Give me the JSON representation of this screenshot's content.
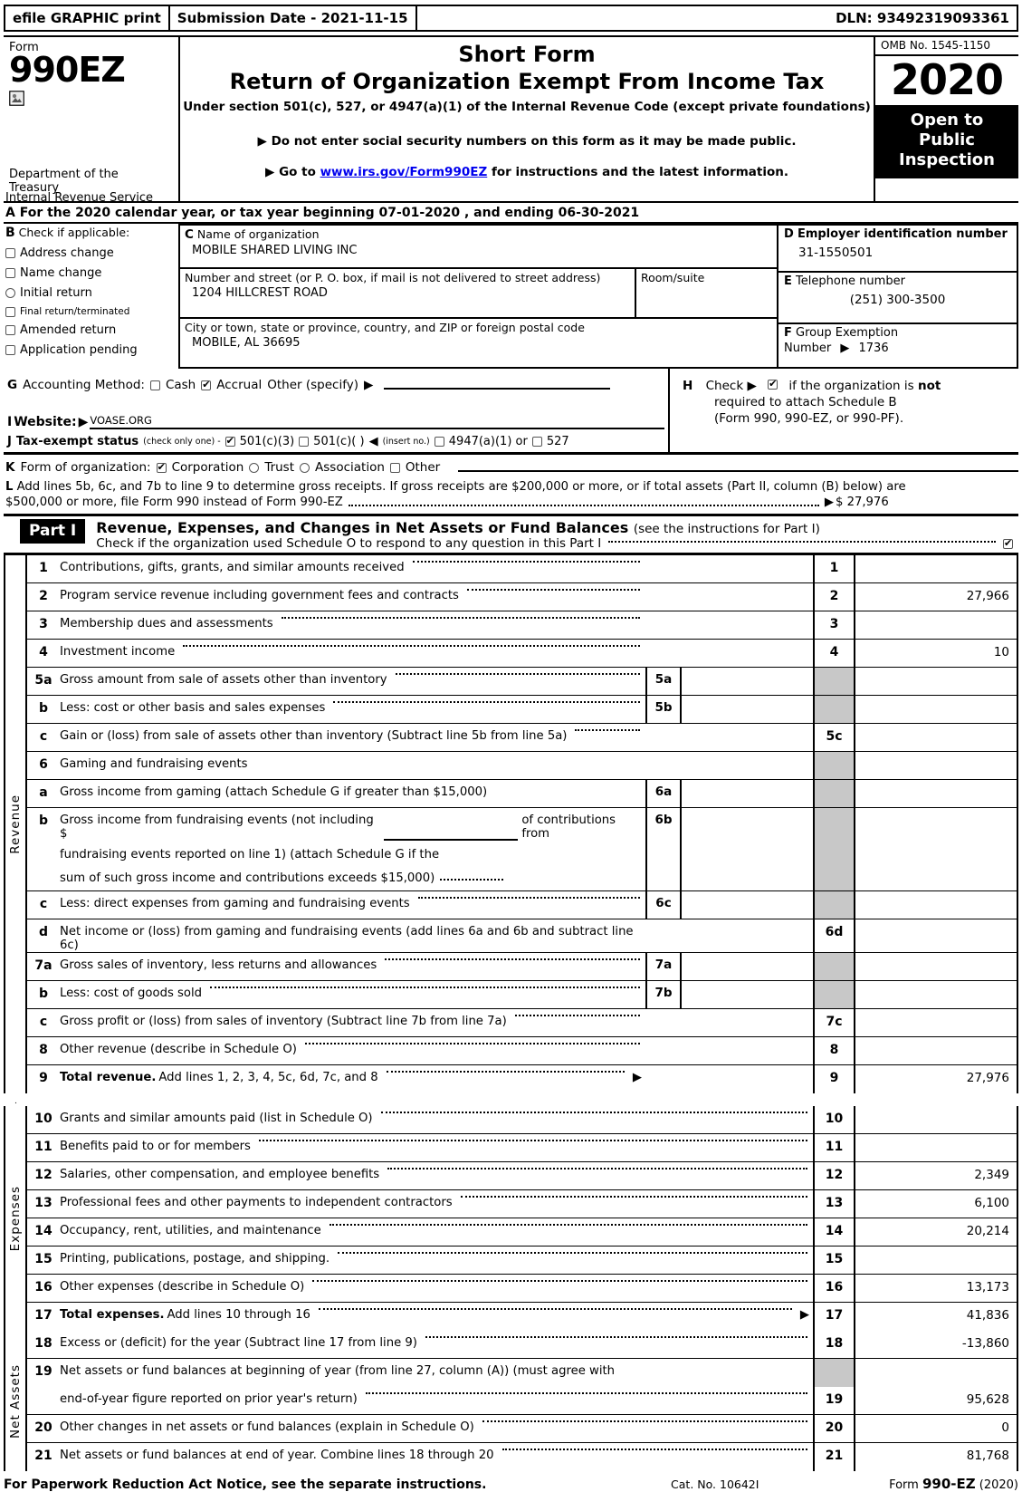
{
  "efile": {
    "graphic_print": "efile GRAPHIC print",
    "submission_date": "Submission Date - 2021-11-15",
    "dln": "DLN: 93492319093361"
  },
  "masthead": {
    "form_label": "Form",
    "form_number": "990EZ",
    "department": "Department of the Treasury",
    "department2": "Internal Revenue Service",
    "title_line1": "Short Form",
    "title_line2": "Return of Organization Exempt From Income Tax",
    "subtitle": "Under section 501(c), 527, or 4947(a)(1) of the Internal Revenue Code (except private foundations)",
    "bullet1": "Do not enter social security numbers on this form as it may be made public.",
    "bullet2_prefix": "Go to",
    "bullet2_url": "www.irs.gov/Form990EZ",
    "bullet2_suffix": "for instructions and the latest information.",
    "omb": "OMB No. 1545-1150",
    "year": "2020",
    "open_to_public": "Open to\nPublic\nInspection"
  },
  "line_a": "A  For the 2020 calendar year, or tax year beginning 07-01-2020 , and ending 06-30-2021",
  "section_b": {
    "letter": "B",
    "heading": "Check if applicable:",
    "items": [
      {
        "label": "Address change",
        "checked": false
      },
      {
        "label": "Name change",
        "checked": false
      },
      {
        "label": "Initial return",
        "checked": false
      },
      {
        "label": "Final return/terminated",
        "checked": false
      },
      {
        "label": "Amended return",
        "checked": false
      },
      {
        "label": "Application pending",
        "checked": false
      }
    ]
  },
  "section_c": {
    "letter": "C",
    "name_label": "Name of organization",
    "name_value": "MOBILE SHARED LIVING INC",
    "street_label": "Number and street (or P. O. box, if mail is not delivered to street address)",
    "street_value": "1204 HILLCREST ROAD",
    "room_label": "Room/suite",
    "room_value": "",
    "city_label": "City or town, state or province, country, and ZIP or foreign postal code",
    "city_value": "MOBILE, AL   36695"
  },
  "section_d": {
    "letter": "D",
    "label": "Employer identification number",
    "value": "31-1550501"
  },
  "section_e": {
    "letter": "E",
    "label": "Telephone number",
    "value": "(251) 300-3500"
  },
  "section_f": {
    "letter": "F",
    "label": "Group Exemption",
    "label2": "Number",
    "value": "1736"
  },
  "section_g": {
    "letter": "G",
    "label": "Accounting Method:",
    "cash": "Cash",
    "cash_checked": false,
    "accrual": "Accrual",
    "accrual_checked": true,
    "other": "Other (specify)",
    "other_value": ""
  },
  "section_h": {
    "letter": "H",
    "check_word": "Check",
    "checked": true,
    "text1": "if the organization is ",
    "text1_bold": "not",
    "text2": "required to attach Schedule B",
    "text3": "(Form 990, 990-EZ, or 990-PF)."
  },
  "section_i": {
    "letter": "I",
    "label": "Website:",
    "value": "VOASE.ORG"
  },
  "section_j": {
    "letter": "J",
    "label": "Tax-exempt status",
    "note": "(check only one) -",
    "options": [
      {
        "label": "501(c)(3)",
        "checked": true
      },
      {
        "label": "501(c)(   )",
        "checked": false
      },
      {
        "label": "4947(a)(1) or",
        "checked": false
      },
      {
        "label": "527",
        "checked": false
      }
    ],
    "insert_no": "(insert no.)"
  },
  "section_k": {
    "letter": "K",
    "label": "Form of organization:",
    "options": [
      {
        "label": "Corporation",
        "checked": true
      },
      {
        "label": "Trust",
        "checked": false
      },
      {
        "label": "Association",
        "checked": false
      },
      {
        "label": "Other",
        "checked": false
      }
    ]
  },
  "section_l": {
    "letter": "L",
    "text1": "Add lines 5b, 6c, and 7b to line 9 to determine gross receipts. If gross receipts are $200,000 or more, or if total assets (Part II, column (B) below) are",
    "text2": "$500,000 or more, file Form 990 instead of Form 990-EZ",
    "amount": "$ 27,976"
  },
  "part1": {
    "tag": "Part I",
    "title": "Revenue, Expenses, and Changes in Net Assets or Fund Balances",
    "title_note": "(see the instructions for Part I)",
    "schedule_o_text": "Check if the organization used Schedule O to respond to any question in this Part I",
    "schedule_o_checked": true
  },
  "sections": {
    "revenue_label": "Revenue",
    "expenses_label": "Expenses",
    "net_assets_label": "Net Assets"
  },
  "revenue_rows": [
    {
      "num": "1",
      "text": "Contributions, gifts, grants, and similar amounts received",
      "dots": true,
      "inner": null,
      "onum": "1",
      "oval": ""
    },
    {
      "num": "2",
      "text": "Program service revenue including government fees and contracts",
      "dots": true,
      "inner": null,
      "onum": "2",
      "oval": "27,966"
    },
    {
      "num": "3",
      "text": "Membership dues and assessments",
      "dots": true,
      "inner": null,
      "onum": "3",
      "oval": ""
    },
    {
      "num": "4",
      "text": "Investment income",
      "dots": true,
      "inner": null,
      "onum": "4",
      "oval": "10"
    },
    {
      "num": "5a",
      "text": "Gross amount from sale of assets other than inventory",
      "dots": true,
      "inner": {
        "num": "5a",
        "val": ""
      },
      "onum": "",
      "onum_grey": true,
      "oval": ""
    },
    {
      "num": "b",
      "text": "Less: cost or other basis and sales expenses",
      "dots": true,
      "inner": {
        "num": "5b",
        "val": ""
      },
      "onum": "",
      "onum_grey": true,
      "oval": ""
    },
    {
      "num": "c",
      "text": "Gain or (loss) from sale of assets other than inventory (Subtract line 5b from line 5a)",
      "dots": true,
      "inner": null,
      "onum": "5c",
      "oval": ""
    },
    {
      "num": "6",
      "text": "Gaming and fundraising events",
      "dots": false,
      "inner": null,
      "onum": "",
      "onum_grey": true,
      "oval": ""
    },
    {
      "num": "a",
      "text": "Gross income from gaming (attach Schedule G if greater than $15,000)",
      "dots": false,
      "inner": {
        "num": "6a",
        "val": ""
      },
      "onum": "",
      "onum_grey": true,
      "oval": ""
    },
    {
      "num": "b",
      "text": "Gross income from fundraising events (not including $",
      "text_cont": "of contributions from",
      "text_l2": "fundraising events reported on line 1) (attach Schedule G if the",
      "text_l3": "sum of such gross income and contributions exceeds $15,000)",
      "dots": true,
      "inner": {
        "num": "6b",
        "val": ""
      },
      "onum": "",
      "onum_grey": true,
      "oval": ""
    },
    {
      "num": "c",
      "text": "Less: direct expenses from gaming and fundraising events",
      "dots": true,
      "inner": {
        "num": "6c",
        "val": ""
      },
      "onum": "",
      "onum_grey": true,
      "oval": ""
    },
    {
      "num": "d",
      "text": "Net income or (loss) from gaming and fundraising events (add lines 6a and 6b and subtract line 6c)",
      "dots": false,
      "inner": null,
      "onum": "6d",
      "oval": ""
    },
    {
      "num": "7a",
      "text": "Gross sales of inventory, less returns and allowances",
      "dots": true,
      "inner": {
        "num": "7a",
        "val": ""
      },
      "onum": "",
      "onum_grey": true,
      "oval": ""
    },
    {
      "num": "b",
      "text": "Less: cost of goods sold",
      "dots": true,
      "inner": {
        "num": "7b",
        "val": ""
      },
      "onum": "",
      "onum_grey": true,
      "oval": ""
    },
    {
      "num": "c",
      "text": "Gross profit or (loss) from sales of inventory (Subtract line 7b from line 7a)",
      "dots": true,
      "inner": null,
      "onum": "7c",
      "oval": ""
    },
    {
      "num": "8",
      "text": "Other revenue (describe in Schedule O)",
      "dots": true,
      "inner": null,
      "onum": "8",
      "oval": ""
    },
    {
      "num": "9",
      "text_bold": "Total revenue.",
      "text": " Add lines 1, 2, 3, 4, 5c, 6d, 7c, and 8",
      "dots": true,
      "arrow": true,
      "inner": null,
      "onum": "9",
      "oval": "27,976"
    }
  ],
  "expense_rows": [
    {
      "num": "10",
      "text": "Grants and similar amounts paid (list in Schedule O)",
      "dots": true,
      "onum": "10",
      "oval": ""
    },
    {
      "num": "11",
      "text": "Benefits paid to or for members",
      "dots": true,
      "onum": "11",
      "oval": ""
    },
    {
      "num": "12",
      "text": "Salaries, other compensation, and employee benefits",
      "dots": true,
      "onum": "12",
      "oval": "2,349"
    },
    {
      "num": "13",
      "text": "Professional fees and other payments to independent contractors",
      "dots": true,
      "onum": "13",
      "oval": "6,100"
    },
    {
      "num": "14",
      "text": "Occupancy, rent, utilities, and maintenance",
      "dots": true,
      "onum": "14",
      "oval": "20,214"
    },
    {
      "num": "15",
      "text": "Printing, publications, postage, and shipping.",
      "dots": true,
      "onum": "15",
      "oval": ""
    },
    {
      "num": "16",
      "text": "Other expenses (describe in Schedule O)",
      "dots": true,
      "onum": "16",
      "oval": "13,173"
    },
    {
      "num": "17",
      "text_bold": "Total expenses.",
      "text": " Add lines 10 through 16",
      "dots": true,
      "arrow": true,
      "onum": "17",
      "oval": "41,836"
    }
  ],
  "net_asset_rows": [
    {
      "num": "18",
      "text": "Excess or (deficit) for the year (Subtract line 17 from line 9)",
      "dots": true,
      "onum": "18",
      "oval": "-13,860"
    },
    {
      "num": "19",
      "text": "Net assets or fund balances at beginning of year (from line 27, column (A)) (must agree with",
      "dots": false,
      "onum": "",
      "onum_grey": true,
      "oval": ""
    },
    {
      "num": "",
      "text": "end-of-year figure reported on prior year's return)",
      "dots": true,
      "onum": "19",
      "oval": "95,628"
    },
    {
      "num": "20",
      "text": "Other changes in net assets or fund balances (explain in Schedule O)",
      "dots": true,
      "onum": "20",
      "oval": "0"
    },
    {
      "num": "21",
      "text": "Net assets or fund balances at end of year. Combine lines 18 through 20",
      "dots": true,
      "onum": "21",
      "oval": "81,768"
    }
  ],
  "footer": {
    "left": "For Paperwork Reduction Act Notice, see the separate instructions.",
    "cat": "Cat. No. 10642I",
    "form_prefix": "Form ",
    "form_bold": "990-EZ",
    "form_year": " (2020)"
  }
}
